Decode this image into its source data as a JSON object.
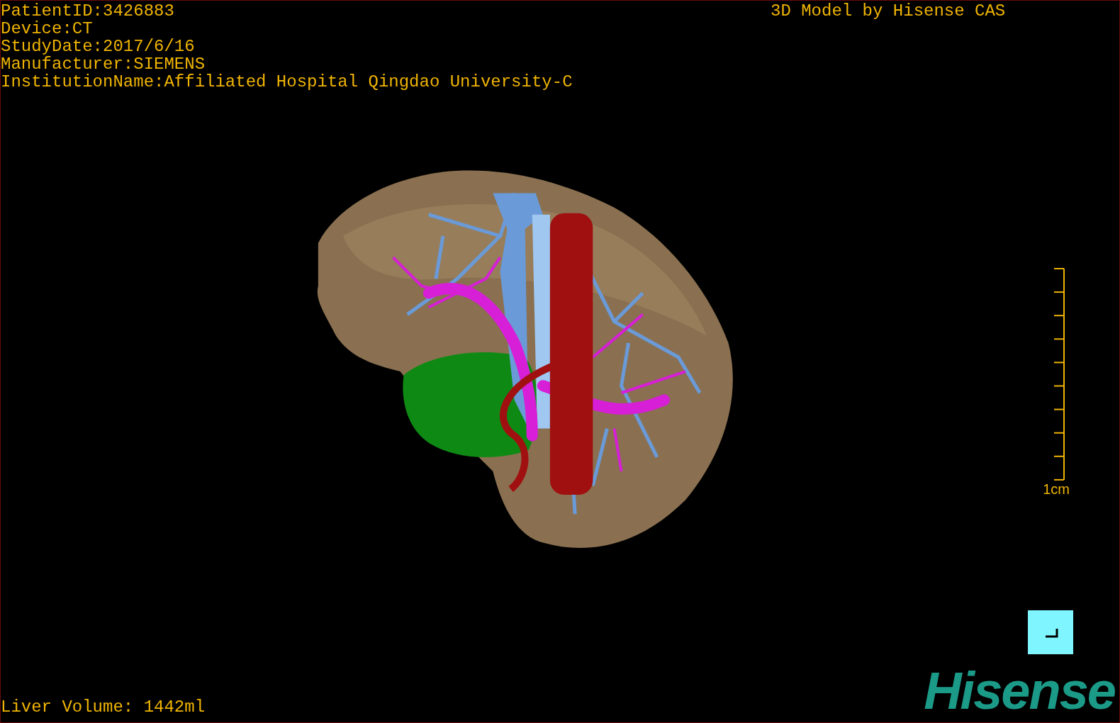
{
  "info_lines": [
    "PatientID:3426883",
    "Device:CT",
    "StudyDate:2017/6/16",
    "Manufacturer:SIEMENS",
    "InstitutionName:Affiliated Hospital Qingdao University-C"
  ],
  "model_caption": "3D Model by Hisense CAS",
  "scale_bar": {
    "label": "1cm"
  },
  "liver_volume": "Liver Volume: 1442ml",
  "logo": "Hisense"
}
